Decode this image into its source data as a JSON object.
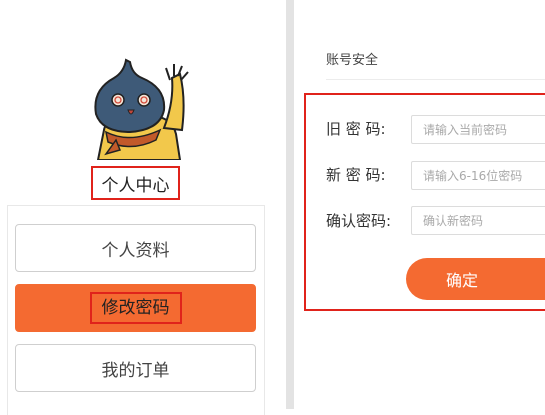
{
  "sidebar": {
    "title": "个人中心",
    "items": [
      {
        "label": "个人资料",
        "active": false
      },
      {
        "label": "修改密码",
        "active": true
      },
      {
        "label": "我的订单",
        "active": false
      }
    ]
  },
  "security": {
    "section_title": "账号安全",
    "old_password": {
      "label": "旧 密 码:",
      "placeholder": "请输入当前密码"
    },
    "new_password": {
      "label": "新 密 码:",
      "placeholder": "请输入6-16位密码"
    },
    "confirm_password": {
      "label": "确认密码:",
      "placeholder": "确认新密码"
    },
    "submit_label": "确定"
  },
  "colors": {
    "accent": "#f46a31",
    "highlight_border": "#e0231b",
    "divider": "#e3e3e3"
  }
}
